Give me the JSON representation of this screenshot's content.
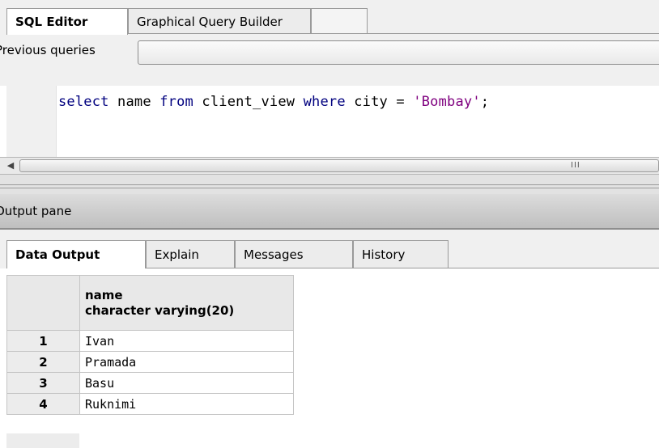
{
  "editor_tabs": [
    "SQL Editor",
    "Graphical Query Builder"
  ],
  "previous_queries": {
    "label": "Previous queries",
    "value": ""
  },
  "sql": {
    "keyword_select": "select",
    "name_col": " name ",
    "keyword_from": "from",
    "table": " client_view ",
    "keyword_where": "where",
    "condition": " city = ",
    "literal": "'Bombay'",
    "terminator": ";"
  },
  "scrollbar": {
    "grip": "III"
  },
  "output_pane": {
    "label": "Output pane"
  },
  "output_tabs": [
    "Data Output",
    "Explain",
    "Messages",
    "History"
  ],
  "grid": {
    "column": {
      "name": "name",
      "type": "character varying(20)"
    },
    "rows": [
      {
        "num": "1",
        "name": "Ivan"
      },
      {
        "num": "2",
        "name": "Pramada"
      },
      {
        "num": "3",
        "name": "Basu"
      },
      {
        "num": "4",
        "name": "Ruknimi"
      }
    ]
  },
  "colors": {
    "keyword": "#00007f",
    "string": "#7f007f",
    "tab_border": "#9a9a9a"
  }
}
